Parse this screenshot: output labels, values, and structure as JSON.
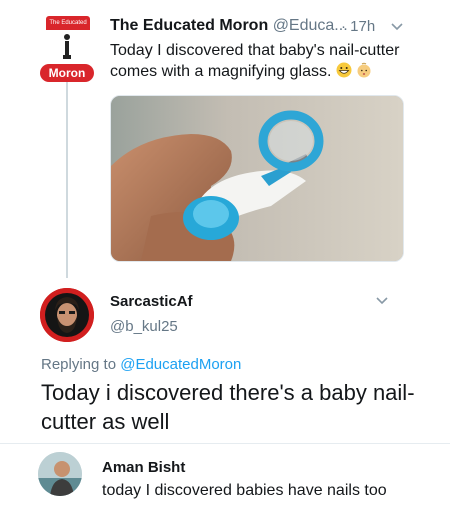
{
  "tweet1": {
    "avatar_label_top": "The Educated",
    "avatar_label": "Moron",
    "name": "The Educated Moron",
    "handle": "@Educa...",
    "time": "· 17h",
    "text": "Today I discovered that baby's nail-cutter comes with a magnifying glass.",
    "emojis": [
      "grinning-face-emoji",
      "baby-emoji"
    ]
  },
  "tweet2": {
    "name": "SarcasticAf",
    "handle": "@b_kul25",
    "replying_prefix": "Replying to ",
    "replying_to": "@EducatedMoron",
    "text": "Today i discovered there's a baby nail-cutter as well"
  },
  "tweet3": {
    "name": "Aman Bisht",
    "text": "today I discovered babies have nails too"
  },
  "colors": {
    "link": "#1da1f2",
    "secondary_text": "#657786",
    "brand_red": "#d9262b",
    "thread_line": "#cfd9de"
  }
}
